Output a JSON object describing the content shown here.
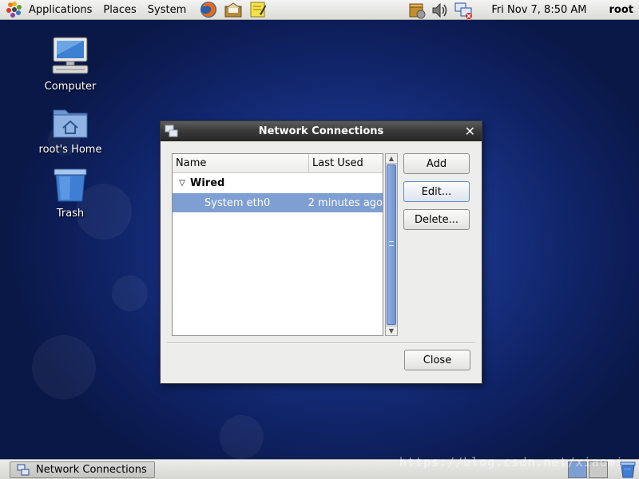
{
  "top_panel": {
    "menus": [
      "Applications",
      "Places",
      "System"
    ],
    "launchers": [
      "firefox-icon",
      "email-icon",
      "notes-icon"
    ],
    "tray": [
      "updates-icon",
      "volume-icon",
      "network-disconnected-icon"
    ],
    "clock": "Fri Nov  7,  8:50 AM",
    "user": "root"
  },
  "desktop": {
    "icons": [
      {
        "label": "Computer",
        "icon": "computer-icon"
      },
      {
        "label": "root's Home",
        "icon": "home-folder-icon"
      },
      {
        "label": "Trash",
        "icon": "trash-icon"
      }
    ]
  },
  "dialog": {
    "title": "Network Connections",
    "columns": {
      "name": "Name",
      "last_used": "Last Used"
    },
    "group": "Wired",
    "connections": [
      {
        "name": "System eth0",
        "last_used": "2 minutes ago",
        "selected": true
      }
    ],
    "buttons": {
      "add": "Add",
      "edit": "Edit...",
      "delete": "Delete...",
      "close": "Close"
    }
  },
  "bottom_panel": {
    "task": "Network Connections",
    "workspaces": 2
  },
  "watermark": "https://blog.csdn.net/xiaomi_",
  "colors": {
    "selection": "#7f9fd2",
    "desktop_blue": "#1a3689",
    "titlebar": "#3b3b3b"
  }
}
